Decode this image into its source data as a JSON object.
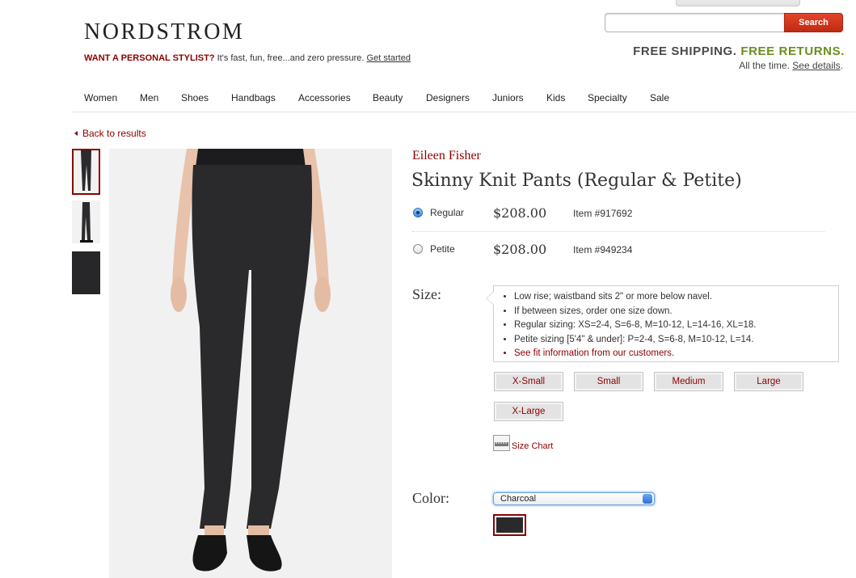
{
  "header": {
    "logo": "NORDSTROM",
    "stylist_highlight": "WANT A PERSONAL STYLIST?",
    "stylist_text": "It's fast, fun, free...and zero pressure.",
    "stylist_link": "Get started",
    "search_value": "",
    "search_button": "Search",
    "shipping_1": "FREE SHIPPING.",
    "shipping_2": "FREE RETURNS.",
    "shipping_sub": "All the time.",
    "shipping_link": "See details"
  },
  "nav": {
    "items": [
      "Women",
      "Men",
      "Shoes",
      "Handbags",
      "Accessories",
      "Beauty",
      "Designers",
      "Juniors",
      "Kids",
      "Specialty",
      "Sale"
    ]
  },
  "breadcrumb": {
    "back": "Back to results"
  },
  "product": {
    "brand": "Eileen Fisher",
    "title": "Skinny Knit Pants (Regular & Petite)",
    "options": [
      {
        "label": "Regular",
        "price": "$208.00",
        "item": "Item #917692",
        "selected": true
      },
      {
        "label": "Petite",
        "price": "$208.00",
        "item": "Item #949234",
        "selected": false
      }
    ]
  },
  "size": {
    "label": "Size:",
    "notes": [
      "Low rise; waistband sits 2\" or more below navel.",
      "If between sizes, order one size down.",
      "Regular sizing: XS=2-4, S=6-8, M=10-12, L=14-16, XL=18.",
      "Petite sizing [5'4\" & under]: P=2-4, S=6-8, M=10-12, L=14."
    ],
    "fit_link": "See fit information from our customers.",
    "buttons": [
      "X-Small",
      "Small",
      "Medium",
      "Large",
      "X-Large"
    ],
    "chart_link": "Size Chart"
  },
  "color": {
    "label": "Color:",
    "selected": "Charcoal",
    "swatch_hex": "#2a292c"
  },
  "colors": {
    "accent": "#8b0000",
    "search_red": "#d0361c",
    "shipping_green": "#6a8e1e"
  }
}
